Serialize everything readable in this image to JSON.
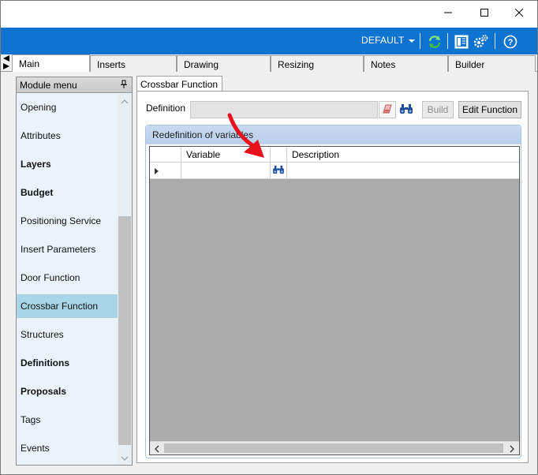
{
  "window": {
    "controls": [
      {
        "name": "minimize-icon"
      },
      {
        "name": "maximize-icon"
      },
      {
        "name": "close-icon"
      }
    ]
  },
  "ribbon": {
    "profile_label": "DEFAULT",
    "icons": [
      "refresh-icon",
      "layout-icon",
      "settings-icon",
      "help-icon"
    ],
    "accent_color": "#0f74cf"
  },
  "tabs": [
    {
      "label": "Main",
      "active": true
    },
    {
      "label": "Inserts",
      "active": false
    },
    {
      "label": "Drawing",
      "active": false
    },
    {
      "label": "Resizing",
      "active": false
    },
    {
      "label": "Notes",
      "active": false
    },
    {
      "label": "Builder",
      "active": false
    }
  ],
  "module_menu": {
    "title": "Module menu",
    "items": [
      {
        "label": "Opening",
        "bold": false,
        "selected": false
      },
      {
        "label": "Attributes",
        "bold": false,
        "selected": false
      },
      {
        "label": "Layers",
        "bold": true,
        "selected": false
      },
      {
        "label": "Budget",
        "bold": true,
        "selected": false
      },
      {
        "label": "Positioning Service",
        "bold": false,
        "selected": false
      },
      {
        "label": "Insert Parameters",
        "bold": false,
        "selected": false
      },
      {
        "label": "Door Function",
        "bold": false,
        "selected": false
      },
      {
        "label": "Crossbar Function",
        "bold": false,
        "selected": true
      },
      {
        "label": "Structures",
        "bold": false,
        "selected": false
      },
      {
        "label": "Definitions",
        "bold": true,
        "selected": false
      },
      {
        "label": "Proposals",
        "bold": true,
        "selected": false
      },
      {
        "label": "Tags",
        "bold": false,
        "selected": false
      },
      {
        "label": "Events",
        "bold": false,
        "selected": false
      }
    ],
    "selected_color": "#a8d6e8"
  },
  "panel": {
    "tab_label": "Crossbar Function",
    "definition_label": "Definition",
    "definition_value": "",
    "build_label": "Build",
    "edit_function_label": "Edit Function",
    "group_title": "Redefinition of variables",
    "grid": {
      "columns": [
        "Variable",
        "Description"
      ],
      "rows": [
        {
          "variable": "",
          "description": ""
        }
      ]
    }
  }
}
